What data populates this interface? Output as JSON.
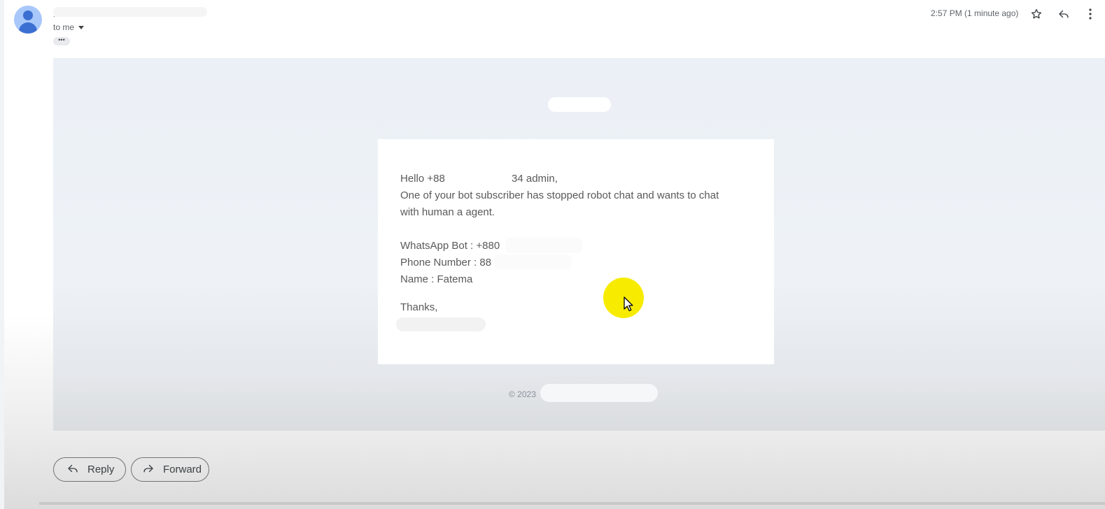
{
  "header": {
    "sender": ".",
    "recipient_label": "to me",
    "more_label": "•••",
    "timestamp": "2:57 PM (1 minute ago)",
    "icons": [
      "star-icon",
      "reply-icon",
      "more-vert-icon"
    ]
  },
  "email": {
    "greeting_prefix": "Hello +88",
    "greeting_suffix": "34 admin,",
    "line1": "One of your bot subscriber has stopped robot chat and wants to chat",
    "line2": "with human a agent.",
    "whatsapp_bot": "WhatsApp Bot : +880",
    "phone_number": "Phone Number : 88",
    "name": "Name : Fatema",
    "thanks": "Thanks,",
    "footer": "© 2023"
  },
  "actions": {
    "reply_label": "Reply",
    "forward_label": "Forward"
  },
  "colors": {
    "email_background": "#ebf0f6",
    "cursor_highlight": "#f7ec00",
    "avatar_bg": "#a8c7fa",
    "avatar_fg": "#3b6fd1"
  }
}
